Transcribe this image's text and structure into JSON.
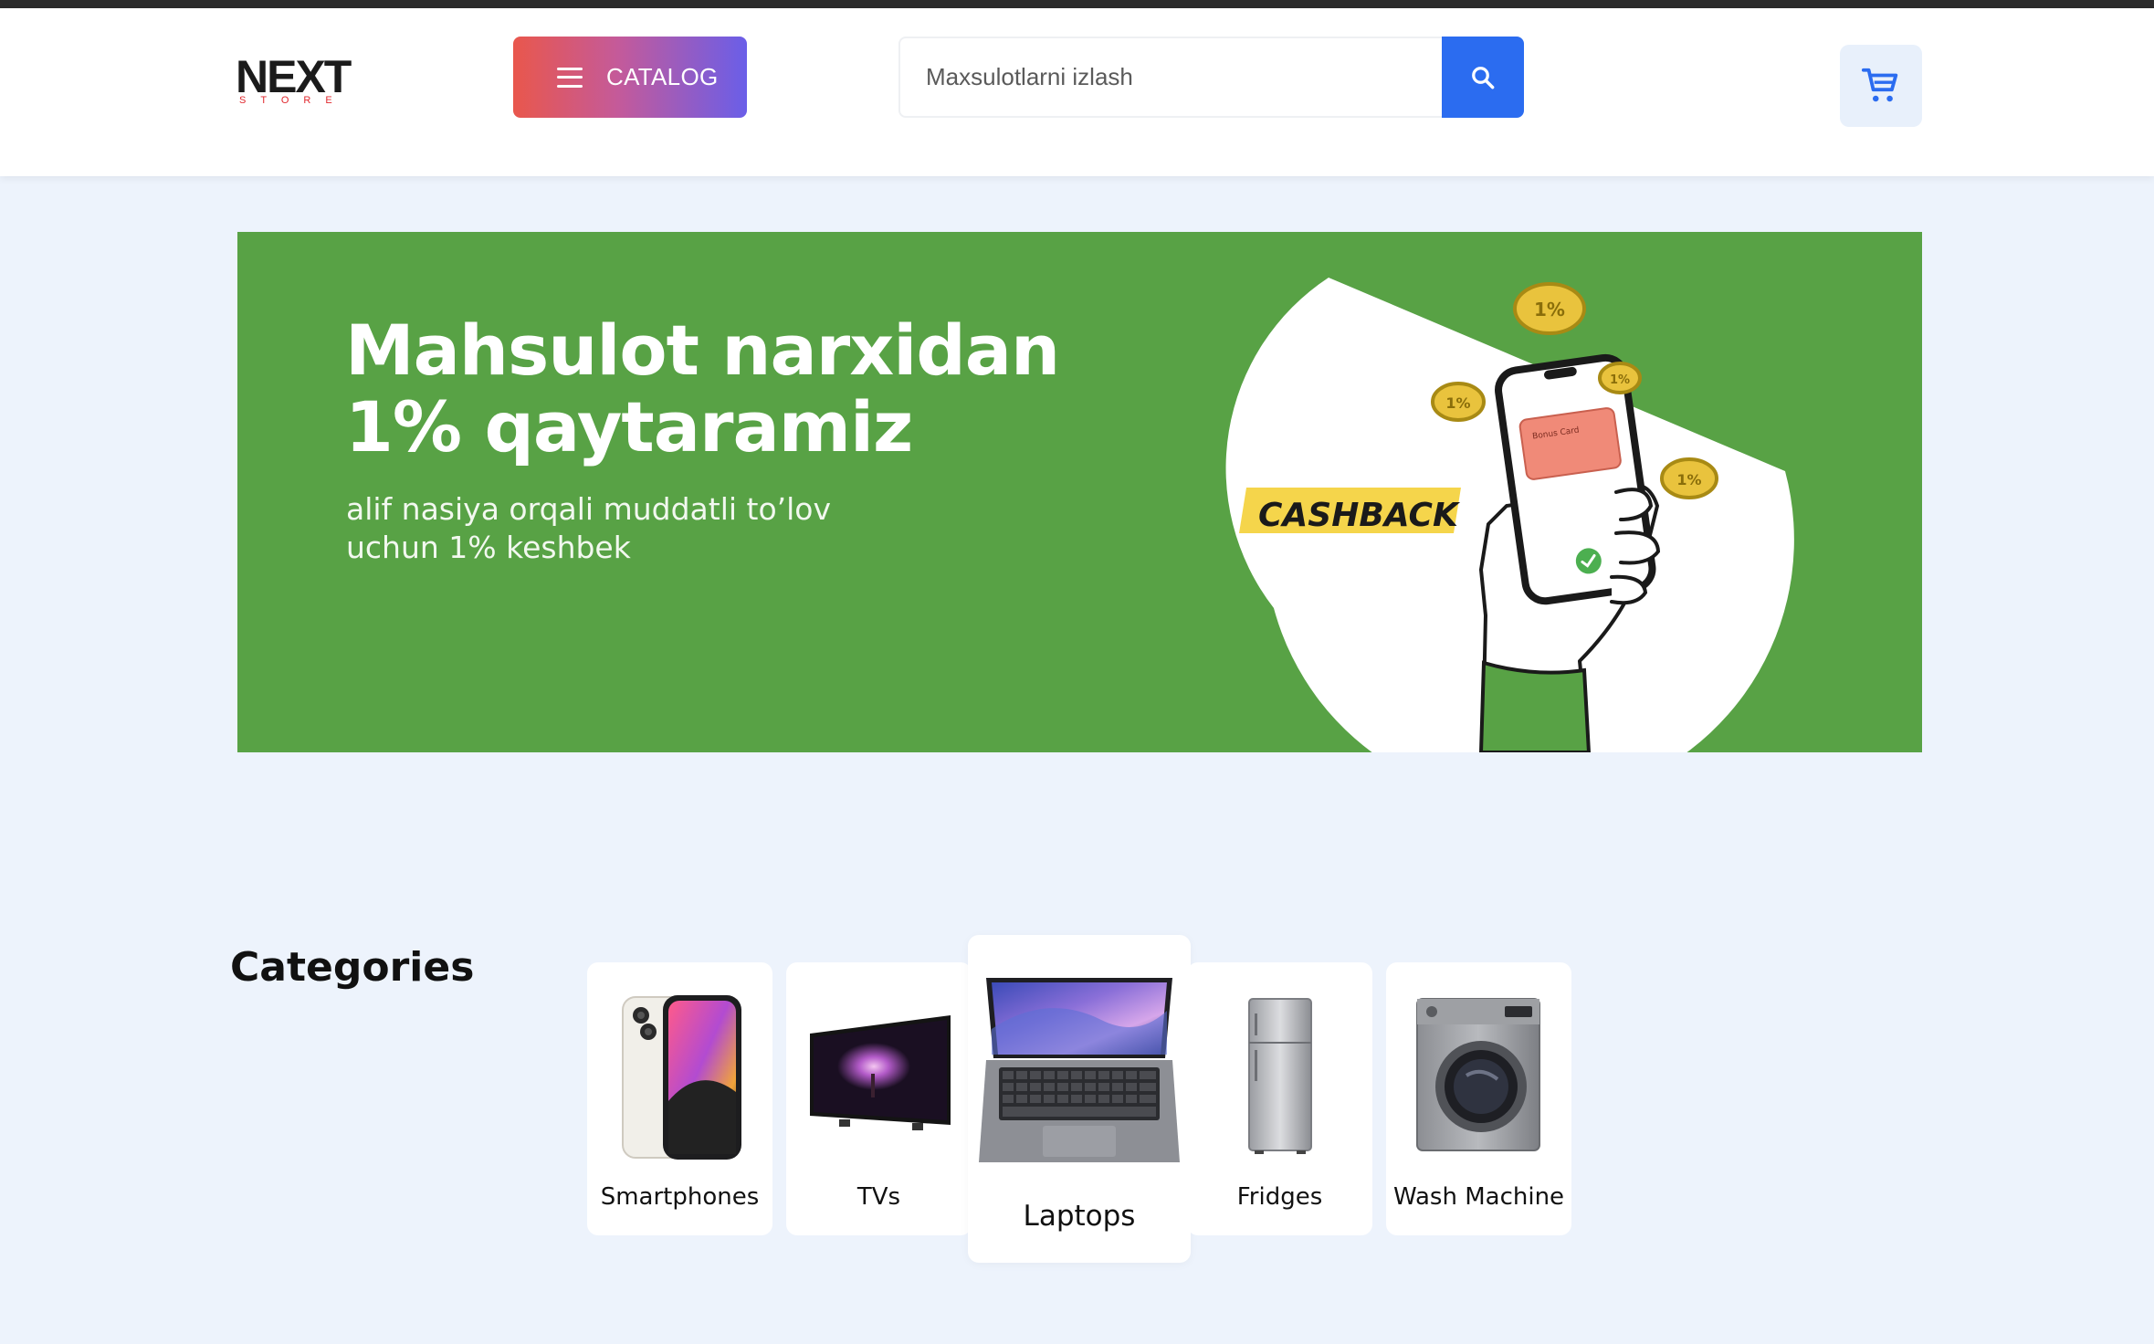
{
  "header": {
    "logo_text": "NEXT",
    "logo_subtext": "STORE",
    "catalog_label": "CATALOG",
    "search_placeholder": "Maxsulotlarni izlash",
    "search_value": "",
    "search_icon": "search-icon",
    "cart_icon": "cart-icon",
    "menu_icon": "menu-icon"
  },
  "banner": {
    "title_line1": "Mahsulot narxidan",
    "title_line2": "1% qaytaramiz",
    "subtitle_line1": "alif nasiya orqali muddatli to’lov",
    "subtitle_line2": "uchun 1% keshbek",
    "badge": "CASHBACK",
    "coin_label": "1%",
    "card_label": "Bonus Card",
    "background_color": "#58a245"
  },
  "categories": {
    "title": "Categories",
    "items": [
      {
        "label": "Smartphones",
        "icon": "smartphone-icon"
      },
      {
        "label": "TVs",
        "icon": "tv-icon"
      },
      {
        "label": "Laptops",
        "icon": "laptop-icon",
        "highlighted": true
      },
      {
        "label": "Fridges",
        "icon": "fridge-icon"
      },
      {
        "label": "Wash Machine",
        "icon": "washing-machine-icon"
      }
    ]
  },
  "colors": {
    "accent_blue": "#2b6cf0",
    "page_background": "#edf3fc",
    "logo_red": "#e0262c"
  }
}
